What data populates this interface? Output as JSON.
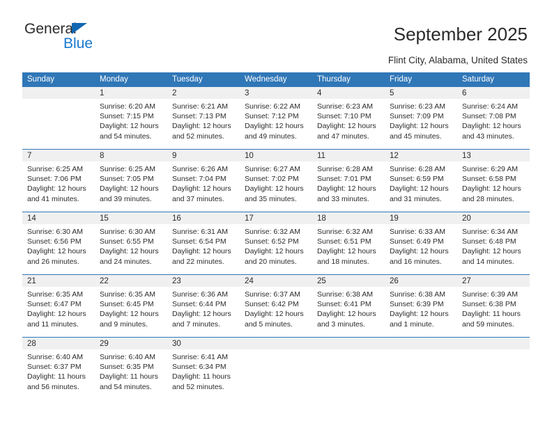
{
  "brand": {
    "name_dark": "General",
    "name_light": "Blue",
    "accent_color": "#1878cf",
    "header_color": "#3077b8"
  },
  "header": {
    "title": "September 2025",
    "subtitle": "Flint City, Alabama, United States"
  },
  "weekday_headers": [
    "Sunday",
    "Monday",
    "Tuesday",
    "Wednesday",
    "Thursday",
    "Friday",
    "Saturday"
  ],
  "weeks": [
    [
      {
        "day": ""
      },
      {
        "day": "1",
        "sunrise": "Sunrise: 6:20 AM",
        "sunset": "Sunset: 7:15 PM",
        "daylight_1": "Daylight: 12 hours",
        "daylight_2": "and 54 minutes."
      },
      {
        "day": "2",
        "sunrise": "Sunrise: 6:21 AM",
        "sunset": "Sunset: 7:13 PM",
        "daylight_1": "Daylight: 12 hours",
        "daylight_2": "and 52 minutes."
      },
      {
        "day": "3",
        "sunrise": "Sunrise: 6:22 AM",
        "sunset": "Sunset: 7:12 PM",
        "daylight_1": "Daylight: 12 hours",
        "daylight_2": "and 49 minutes."
      },
      {
        "day": "4",
        "sunrise": "Sunrise: 6:23 AM",
        "sunset": "Sunset: 7:10 PM",
        "daylight_1": "Daylight: 12 hours",
        "daylight_2": "and 47 minutes."
      },
      {
        "day": "5",
        "sunrise": "Sunrise: 6:23 AM",
        "sunset": "Sunset: 7:09 PM",
        "daylight_1": "Daylight: 12 hours",
        "daylight_2": "and 45 minutes."
      },
      {
        "day": "6",
        "sunrise": "Sunrise: 6:24 AM",
        "sunset": "Sunset: 7:08 PM",
        "daylight_1": "Daylight: 12 hours",
        "daylight_2": "and 43 minutes."
      }
    ],
    [
      {
        "day": "7",
        "sunrise": "Sunrise: 6:25 AM",
        "sunset": "Sunset: 7:06 PM",
        "daylight_1": "Daylight: 12 hours",
        "daylight_2": "and 41 minutes."
      },
      {
        "day": "8",
        "sunrise": "Sunrise: 6:25 AM",
        "sunset": "Sunset: 7:05 PM",
        "daylight_1": "Daylight: 12 hours",
        "daylight_2": "and 39 minutes."
      },
      {
        "day": "9",
        "sunrise": "Sunrise: 6:26 AM",
        "sunset": "Sunset: 7:04 PM",
        "daylight_1": "Daylight: 12 hours",
        "daylight_2": "and 37 minutes."
      },
      {
        "day": "10",
        "sunrise": "Sunrise: 6:27 AM",
        "sunset": "Sunset: 7:02 PM",
        "daylight_1": "Daylight: 12 hours",
        "daylight_2": "and 35 minutes."
      },
      {
        "day": "11",
        "sunrise": "Sunrise: 6:28 AM",
        "sunset": "Sunset: 7:01 PM",
        "daylight_1": "Daylight: 12 hours",
        "daylight_2": "and 33 minutes."
      },
      {
        "day": "12",
        "sunrise": "Sunrise: 6:28 AM",
        "sunset": "Sunset: 6:59 PM",
        "daylight_1": "Daylight: 12 hours",
        "daylight_2": "and 31 minutes."
      },
      {
        "day": "13",
        "sunrise": "Sunrise: 6:29 AM",
        "sunset": "Sunset: 6:58 PM",
        "daylight_1": "Daylight: 12 hours",
        "daylight_2": "and 28 minutes."
      }
    ],
    [
      {
        "day": "14",
        "sunrise": "Sunrise: 6:30 AM",
        "sunset": "Sunset: 6:56 PM",
        "daylight_1": "Daylight: 12 hours",
        "daylight_2": "and 26 minutes."
      },
      {
        "day": "15",
        "sunrise": "Sunrise: 6:30 AM",
        "sunset": "Sunset: 6:55 PM",
        "daylight_1": "Daylight: 12 hours",
        "daylight_2": "and 24 minutes."
      },
      {
        "day": "16",
        "sunrise": "Sunrise: 6:31 AM",
        "sunset": "Sunset: 6:54 PM",
        "daylight_1": "Daylight: 12 hours",
        "daylight_2": "and 22 minutes."
      },
      {
        "day": "17",
        "sunrise": "Sunrise: 6:32 AM",
        "sunset": "Sunset: 6:52 PM",
        "daylight_1": "Daylight: 12 hours",
        "daylight_2": "and 20 minutes."
      },
      {
        "day": "18",
        "sunrise": "Sunrise: 6:32 AM",
        "sunset": "Sunset: 6:51 PM",
        "daylight_1": "Daylight: 12 hours",
        "daylight_2": "and 18 minutes."
      },
      {
        "day": "19",
        "sunrise": "Sunrise: 6:33 AM",
        "sunset": "Sunset: 6:49 PM",
        "daylight_1": "Daylight: 12 hours",
        "daylight_2": "and 16 minutes."
      },
      {
        "day": "20",
        "sunrise": "Sunrise: 6:34 AM",
        "sunset": "Sunset: 6:48 PM",
        "daylight_1": "Daylight: 12 hours",
        "daylight_2": "and 14 minutes."
      }
    ],
    [
      {
        "day": "21",
        "sunrise": "Sunrise: 6:35 AM",
        "sunset": "Sunset: 6:47 PM",
        "daylight_1": "Daylight: 12 hours",
        "daylight_2": "and 11 minutes."
      },
      {
        "day": "22",
        "sunrise": "Sunrise: 6:35 AM",
        "sunset": "Sunset: 6:45 PM",
        "daylight_1": "Daylight: 12 hours",
        "daylight_2": "and 9 minutes."
      },
      {
        "day": "23",
        "sunrise": "Sunrise: 6:36 AM",
        "sunset": "Sunset: 6:44 PM",
        "daylight_1": "Daylight: 12 hours",
        "daylight_2": "and 7 minutes."
      },
      {
        "day": "24",
        "sunrise": "Sunrise: 6:37 AM",
        "sunset": "Sunset: 6:42 PM",
        "daylight_1": "Daylight: 12 hours",
        "daylight_2": "and 5 minutes."
      },
      {
        "day": "25",
        "sunrise": "Sunrise: 6:38 AM",
        "sunset": "Sunset: 6:41 PM",
        "daylight_1": "Daylight: 12 hours",
        "daylight_2": "and 3 minutes."
      },
      {
        "day": "26",
        "sunrise": "Sunrise: 6:38 AM",
        "sunset": "Sunset: 6:39 PM",
        "daylight_1": "Daylight: 12 hours",
        "daylight_2": "and 1 minute."
      },
      {
        "day": "27",
        "sunrise": "Sunrise: 6:39 AM",
        "sunset": "Sunset: 6:38 PM",
        "daylight_1": "Daylight: 11 hours",
        "daylight_2": "and 59 minutes."
      }
    ],
    [
      {
        "day": "28",
        "sunrise": "Sunrise: 6:40 AM",
        "sunset": "Sunset: 6:37 PM",
        "daylight_1": "Daylight: 11 hours",
        "daylight_2": "and 56 minutes."
      },
      {
        "day": "29",
        "sunrise": "Sunrise: 6:40 AM",
        "sunset": "Sunset: 6:35 PM",
        "daylight_1": "Daylight: 11 hours",
        "daylight_2": "and 54 minutes."
      },
      {
        "day": "30",
        "sunrise": "Sunrise: 6:41 AM",
        "sunset": "Sunset: 6:34 PM",
        "daylight_1": "Daylight: 11 hours",
        "daylight_2": "and 52 minutes."
      },
      {
        "day": ""
      },
      {
        "day": ""
      },
      {
        "day": ""
      },
      {
        "day": ""
      }
    ]
  ]
}
